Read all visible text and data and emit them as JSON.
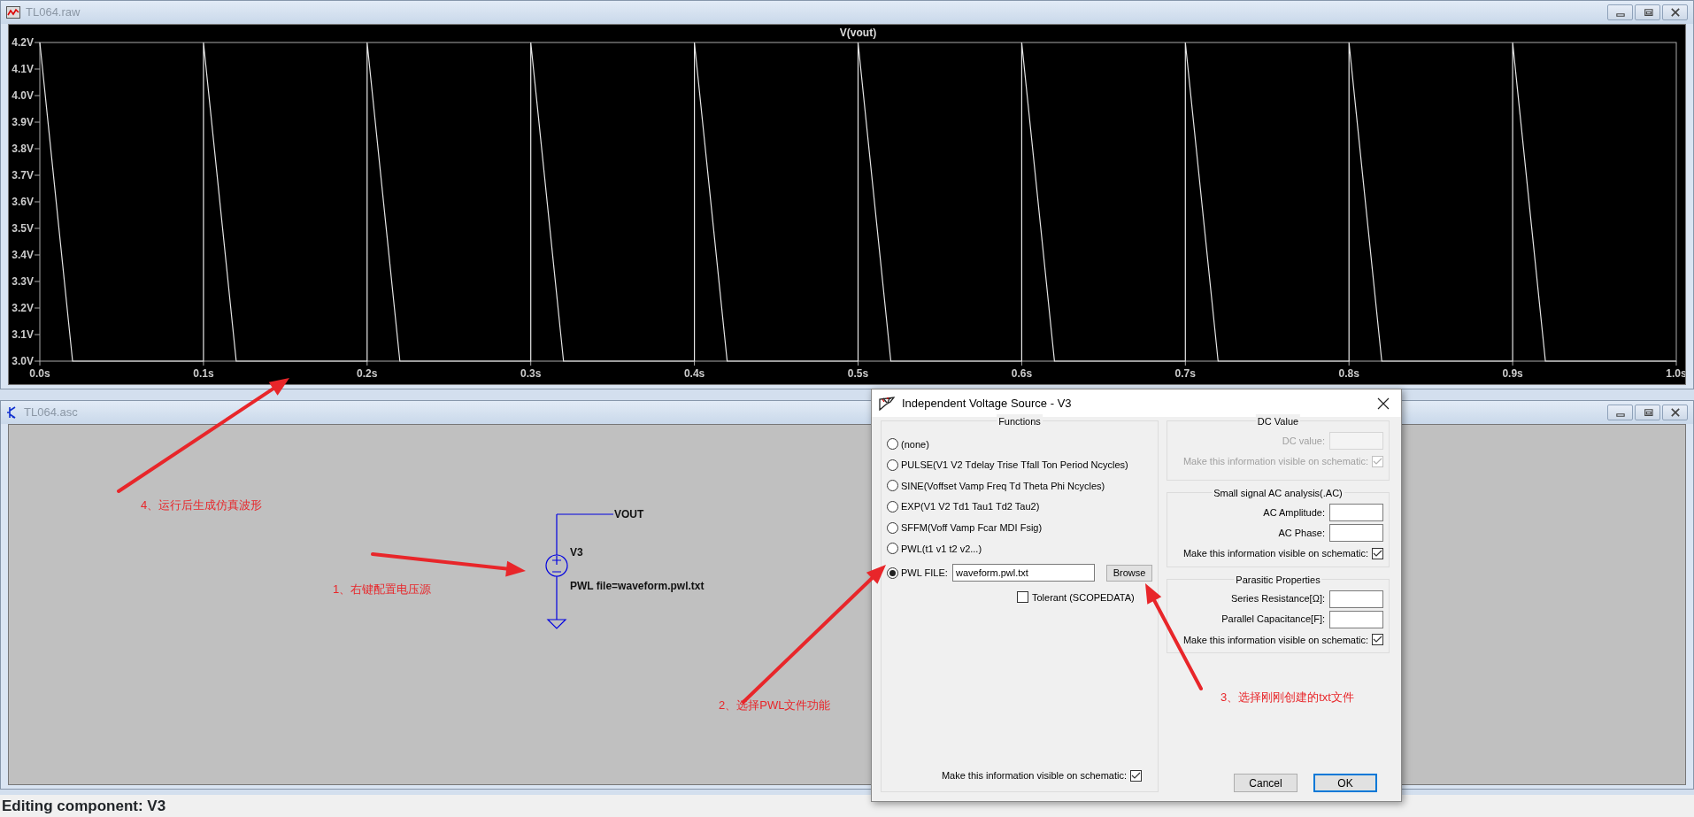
{
  "plot_window": {
    "title": "TL064.raw",
    "chart_data": {
      "type": "line",
      "title": "V(vout)",
      "x": [
        0,
        0.02,
        0.1,
        0.1,
        0.12,
        0.2,
        0.2,
        0.22,
        0.3,
        0.3,
        0.32,
        0.4,
        0.4,
        0.42,
        0.5,
        0.5,
        0.52,
        0.6,
        0.6,
        0.62,
        0.7,
        0.7,
        0.72,
        0.8,
        0.8,
        0.82,
        0.9,
        0.9,
        0.92,
        1.0
      ],
      "values": [
        4.2,
        3.0,
        3.0,
        4.2,
        3.0,
        3.0,
        4.2,
        3.0,
        3.0,
        4.2,
        3.0,
        3.0,
        4.2,
        3.0,
        3.0,
        4.2,
        3.0,
        3.0,
        4.2,
        3.0,
        3.0,
        4.2,
        3.0,
        3.0,
        4.2,
        3.0,
        3.0,
        4.2,
        3.0,
        3.0
      ],
      "xlim": [
        0,
        1
      ],
      "ylim": [
        3.0,
        4.2
      ],
      "xticks": [
        {
          "value": 0,
          "label": "0.0s"
        },
        {
          "value": 0.1,
          "label": "0.1s"
        },
        {
          "value": 0.2,
          "label": "0.2s"
        },
        {
          "value": 0.3,
          "label": "0.3s"
        },
        {
          "value": 0.4,
          "label": "0.4s"
        },
        {
          "value": 0.5,
          "label": "0.5s"
        },
        {
          "value": 0.6,
          "label": "0.6s"
        },
        {
          "value": 0.7,
          "label": "0.7s"
        },
        {
          "value": 0.8,
          "label": "0.8s"
        },
        {
          "value": 0.9,
          "label": "0.9s"
        },
        {
          "value": 1.0,
          "label": "1.0s"
        }
      ],
      "yticks": [
        {
          "value": 3.0,
          "label": "3.0V"
        },
        {
          "value": 3.1,
          "label": "3.1V"
        },
        {
          "value": 3.2,
          "label": "3.2V"
        },
        {
          "value": 3.3,
          "label": "3.3V"
        },
        {
          "value": 3.4,
          "label": "3.4V"
        },
        {
          "value": 3.5,
          "label": "3.5V"
        },
        {
          "value": 3.6,
          "label": "3.6V"
        },
        {
          "value": 3.7,
          "label": "3.7V"
        },
        {
          "value": 3.8,
          "label": "3.8V"
        },
        {
          "value": 3.9,
          "label": "3.9V"
        },
        {
          "value": 4.0,
          "label": "4.0V"
        },
        {
          "value": 4.1,
          "label": "4.1V"
        },
        {
          "value": 4.2,
          "label": "4.2V"
        }
      ]
    }
  },
  "schematic_window": {
    "title": "TL064.asc",
    "labels": [
      {
        "kind": "net",
        "text": "VOUT"
      },
      {
        "kind": "ref",
        "text": "V3"
      },
      {
        "kind": "value",
        "text": "PWL file=waveform.pwl.txt"
      }
    ]
  },
  "annotations": [
    {
      "text": "1、右键配置电压源"
    },
    {
      "text": "2、选择PWL文件功能"
    },
    {
      "text": "3、选择刚刚创建的txt文件"
    },
    {
      "text": "4、运行后生成仿真波形"
    }
  ],
  "dialog": {
    "title": "Independent Voltage Source - V3",
    "functions": {
      "legend": "Functions",
      "options": [
        {
          "label": "(none)",
          "selected": false,
          "kind": "plain"
        },
        {
          "label": "PULSE(V1 V2 Tdelay Trise Tfall Ton Period Ncycles)",
          "selected": false,
          "kind": "plain"
        },
        {
          "label": "SINE(Voffset Vamp Freq Td Theta Phi Ncycles)",
          "selected": false,
          "kind": "plain"
        },
        {
          "label": "EXP(V1 V2 Td1 Tau1 Td2 Tau2)",
          "selected": false,
          "kind": "plain"
        },
        {
          "label": "SFFM(Voff Vamp Fcar MDI Fsig)",
          "selected": false,
          "kind": "plain"
        },
        {
          "label": "PWL(t1 v1 t2 v2...)",
          "selected": false,
          "kind": "plain"
        },
        {
          "label": "PWL FILE:",
          "selected": true,
          "kind": "file"
        }
      ],
      "file_value": "waveform.pwl.txt",
      "browse": "Browse",
      "tolerant": {
        "label": "Tolerant (SCOPEDATA)",
        "checked": false
      },
      "visible": {
        "label": "Make this information visible on schematic:",
        "checked": true
      }
    },
    "groups": [
      {
        "legend": "DC Value",
        "disabled": true,
        "fields": [
          {
            "label": "DC value:"
          }
        ],
        "visible": {
          "label": "Make this information visible on schematic:",
          "checked": true
        }
      },
      {
        "legend": "Small signal AC analysis(.AC)",
        "disabled": false,
        "fields": [
          {
            "label": "AC Amplitude:"
          },
          {
            "label": "AC Phase:"
          }
        ],
        "visible": {
          "label": "Make this information visible on schematic:",
          "checked": true
        }
      },
      {
        "legend": "Parasitic Properties",
        "disabled": false,
        "fields": [
          {
            "label": "Series Resistance[Ω]:"
          },
          {
            "label": "Parallel Capacitance[F]:"
          }
        ],
        "visible": {
          "label": "Make this information visible on schematic:",
          "checked": true
        }
      }
    ],
    "buttons": [
      {
        "label": "Cancel",
        "default": false
      },
      {
        "label": "OK",
        "default": true
      }
    ]
  },
  "status_bar": "Editing component: V3"
}
